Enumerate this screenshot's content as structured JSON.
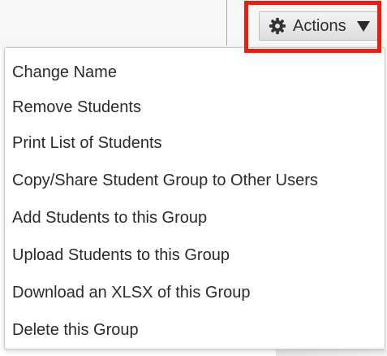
{
  "actions_button": {
    "label": "Actions",
    "icon": "gear-icon",
    "dropdown_icon": "caret-down-icon",
    "highlight_color": "#ee1c0c"
  },
  "menu": {
    "items": [
      {
        "label": "Change Name"
      },
      {
        "label": "Remove Students"
      },
      {
        "label": "Print List of Students"
      },
      {
        "label": "Copy/Share Student Group to Other Users"
      },
      {
        "label": "Add Students to this Group"
      },
      {
        "label": "Upload Students to this Group"
      },
      {
        "label": "Download an XLSX of this Group"
      },
      {
        "label": "Delete this Group"
      }
    ]
  }
}
